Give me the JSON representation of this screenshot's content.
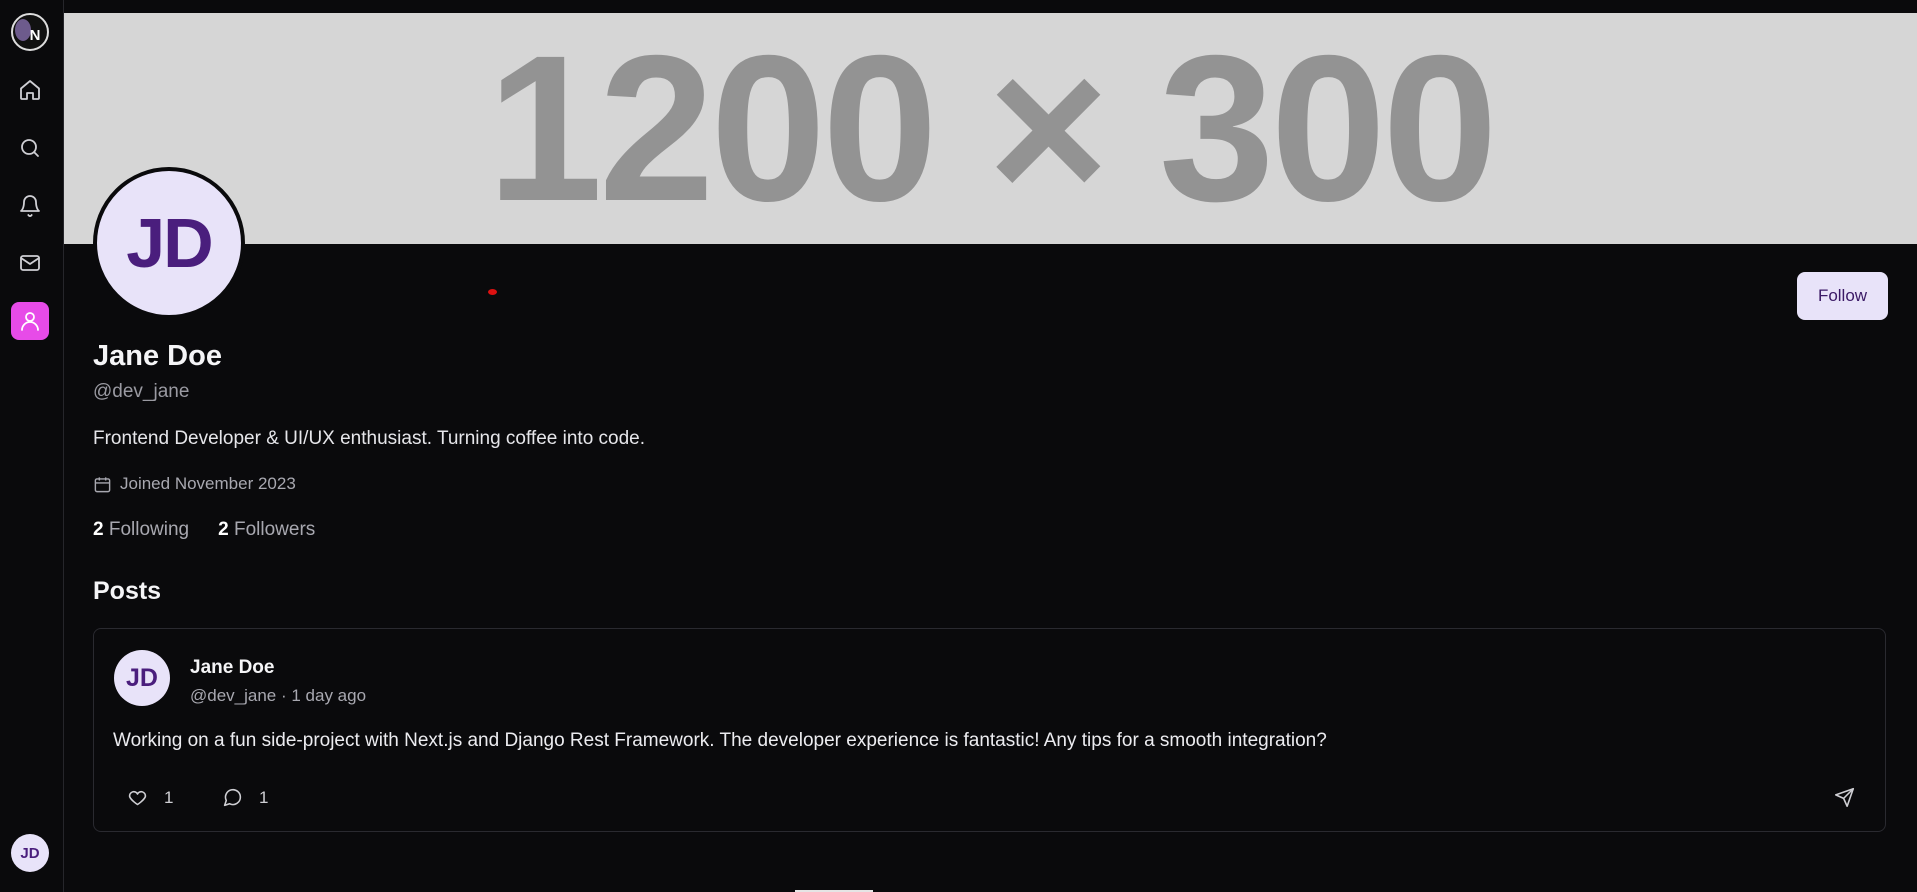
{
  "sidebar": {
    "logo_letter": "N",
    "items": [
      {
        "name": "home",
        "icon": "home-icon"
      },
      {
        "name": "search",
        "icon": "search-icon"
      },
      {
        "name": "notifications",
        "icon": "bell-icon"
      },
      {
        "name": "messages",
        "icon": "mail-icon"
      },
      {
        "name": "profile",
        "icon": "user-icon",
        "active": true
      }
    ],
    "user_initials": "JD"
  },
  "banner": {
    "placeholder_text": "1200 × 300"
  },
  "profile": {
    "initials": "JD",
    "name": "Jane Doe",
    "handle": "@dev_jane",
    "bio": "Frontend Developer & UI/UX enthusiast. Turning coffee into code.",
    "joined": "Joined November 2023",
    "following_count": "2",
    "following_label": "Following",
    "followers_count": "2",
    "followers_label": "Followers",
    "follow_label": "Follow"
  },
  "posts": {
    "heading": "Posts",
    "items": [
      {
        "initials": "JD",
        "author": "Jane Doe",
        "meta": "@dev_jane · 1 day ago",
        "content": "Working on a fun side-project with Next.js and Django Rest Framework. The developer experience is fantastic! Any tips for a smooth integration?",
        "likes": "1",
        "comments": "1"
      }
    ]
  },
  "colors": {
    "background": "#0a0a0c",
    "accent": "#e74be8",
    "avatar_bg": "#e8e3f9",
    "avatar_text": "#4a1e7d"
  }
}
